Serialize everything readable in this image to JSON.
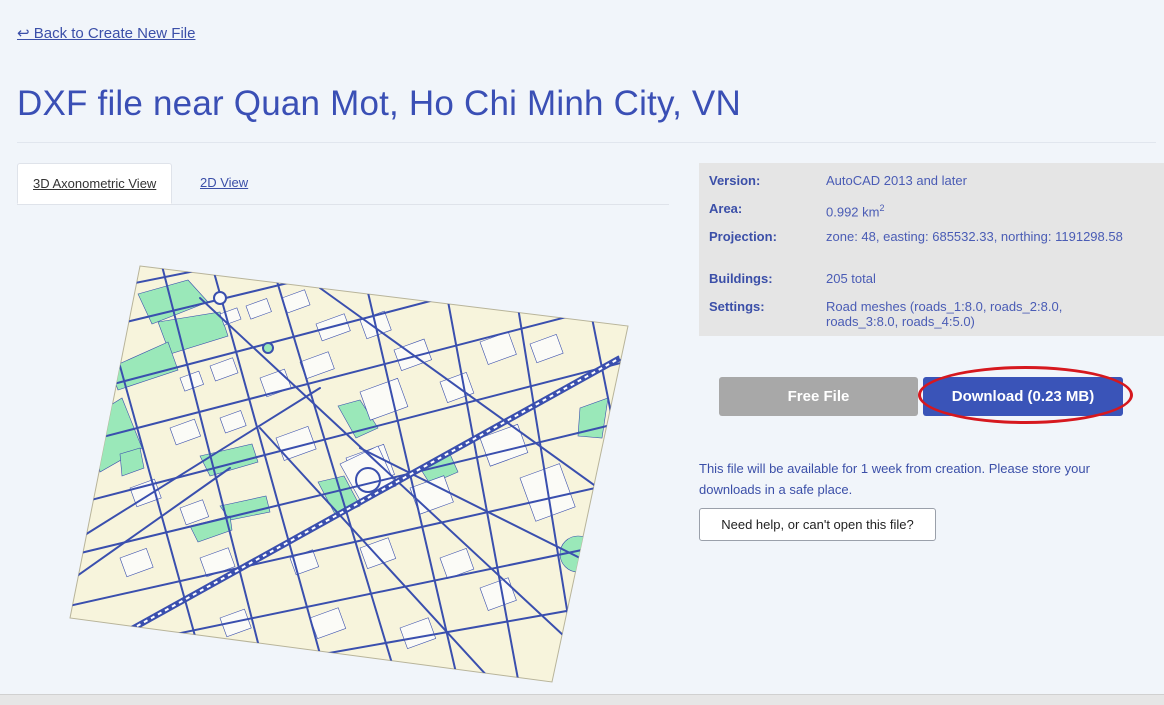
{
  "nav": {
    "back_label": "↩ Back to Create New File"
  },
  "page": {
    "title": "DXF file near Quan Mot, Ho Chi Minh City, VN"
  },
  "tabs": [
    {
      "label": "3D Axonometric View",
      "active": true
    },
    {
      "label": "2D View",
      "active": false
    }
  ],
  "info": {
    "version": {
      "label": "Version:",
      "value": "AutoCAD 2013 and later"
    },
    "area": {
      "label": "Area:",
      "value": "0.992 km",
      "unit_sup": "2"
    },
    "projection": {
      "label": "Projection:",
      "value": "zone: 48, easting: 685532.33, northing: 1191298.58"
    },
    "buildings": {
      "label": "Buildings:",
      "value": "205 total"
    },
    "settings": {
      "label": "Settings:",
      "value": "Road meshes (roads_1:8.0, roads_2:8.0, roads_3:8.0, roads_4:5.0)"
    }
  },
  "actions": {
    "free_label": "Free File",
    "download_label": "Download (0.23 MB)",
    "notice": "This file will be available for 1 week from creation. Please store your downloads in a safe place.",
    "help_label": "Need help, or can't open this file?"
  },
  "colors": {
    "accent": "#3a54b8",
    "map_background": "#f7f4dc",
    "map_roads": "#3a4fae",
    "map_parks": "#9ae8b9",
    "highlight": "#d6181e"
  }
}
